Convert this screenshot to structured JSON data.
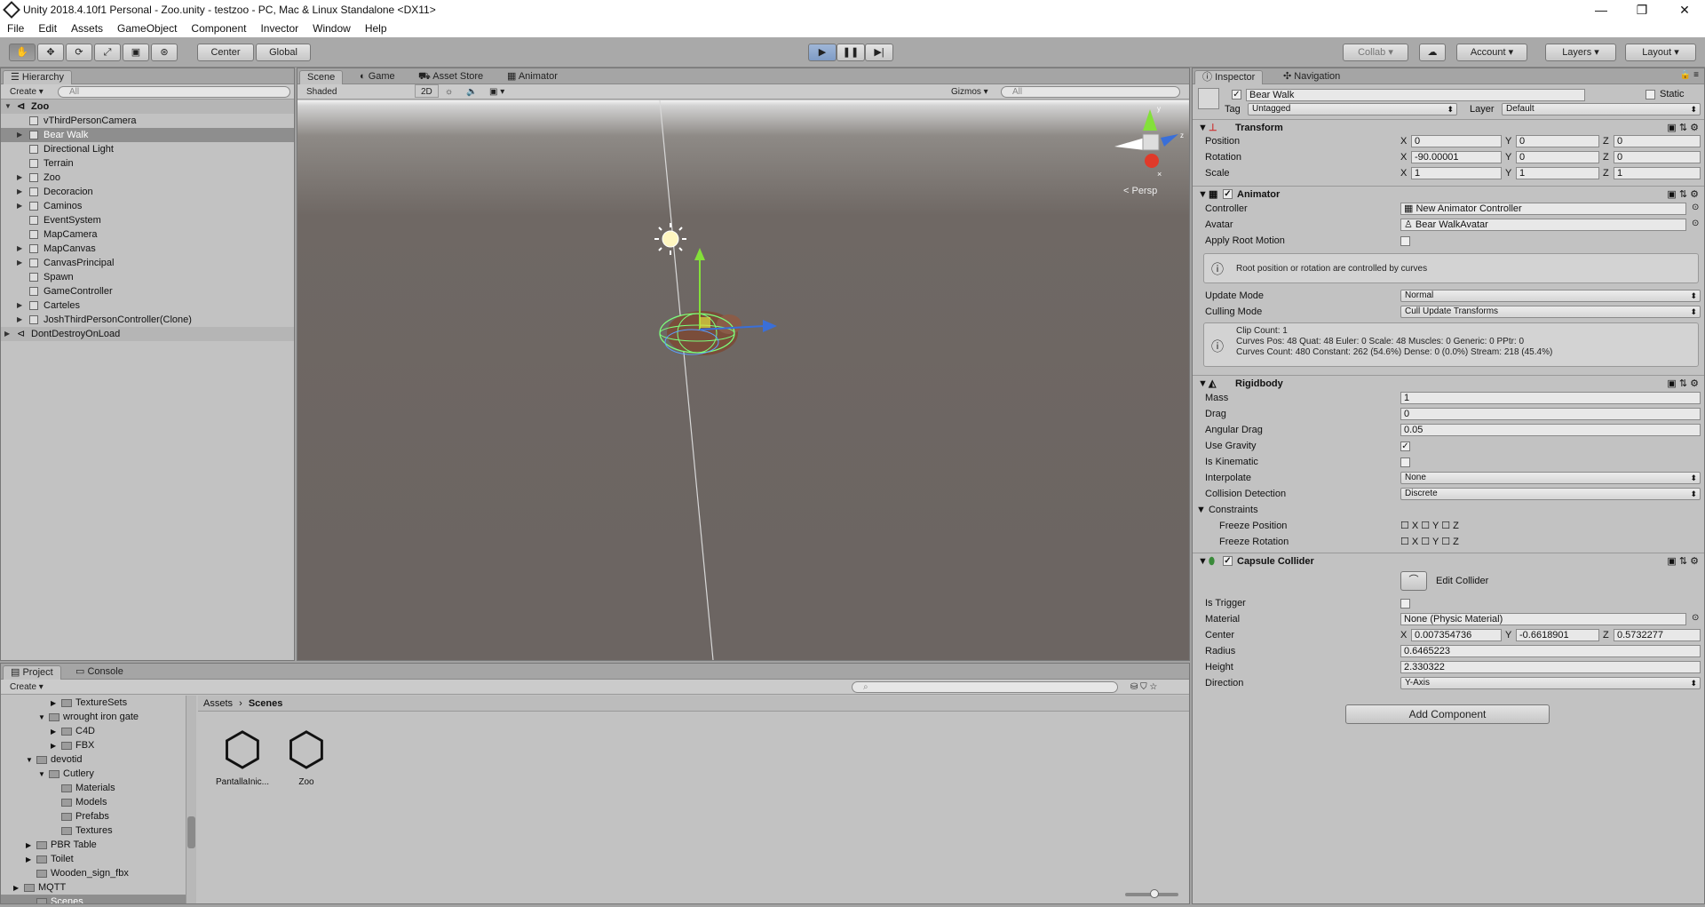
{
  "window": {
    "title": "Unity 2018.4.10f1 Personal - Zoo.unity - testzoo - PC, Mac & Linux Standalone <DX11>"
  },
  "menu": [
    "File",
    "Edit",
    "Assets",
    "GameObject",
    "Component",
    "Invector",
    "Window",
    "Help"
  ],
  "toolbar": {
    "center": "Center",
    "global": "Global",
    "collab": "Collab ▾",
    "account": "Account",
    "layers": "Layers",
    "layout": "Layout"
  },
  "hierarchy": {
    "tab": "Hierarchy",
    "create": "Create ▾",
    "search_placeholder": "All",
    "scene_root": "Zoo",
    "items": [
      {
        "label": "vThirdPersonCamera",
        "arrow": false,
        "selected": false
      },
      {
        "label": "Bear Walk",
        "arrow": true,
        "selected": true
      },
      {
        "label": "Directional Light",
        "arrow": false,
        "selected": false
      },
      {
        "label": "Terrain",
        "arrow": false,
        "selected": false
      },
      {
        "label": "Zoo",
        "arrow": true,
        "selected": false
      },
      {
        "label": "Decoracion",
        "arrow": true,
        "selected": false
      },
      {
        "label": "Caminos",
        "arrow": true,
        "selected": false
      },
      {
        "label": "EventSystem",
        "arrow": false,
        "selected": false
      },
      {
        "label": "MapCamera",
        "arrow": false,
        "selected": false
      },
      {
        "label": "MapCanvas",
        "arrow": true,
        "selected": false
      },
      {
        "label": "CanvasPrincipal",
        "arrow": true,
        "selected": false
      },
      {
        "label": "Spawn",
        "arrow": false,
        "selected": false
      },
      {
        "label": "GameController",
        "arrow": false,
        "selected": false
      },
      {
        "label": "Carteles",
        "arrow": true,
        "selected": false
      },
      {
        "label": "JoshThirdPersonController(Clone)",
        "arrow": true,
        "selected": false
      }
    ],
    "dont_destroy": "DontDestroyOnLoad"
  },
  "scene": {
    "tabs": [
      "Scene",
      "Game",
      "Asset Store",
      "Animator"
    ],
    "shading": "Shaded",
    "mode2d": "2D",
    "gizmos": "Gizmos",
    "search_placeholder": "All",
    "persp": "< Persp"
  },
  "inspector": {
    "tabs": [
      "Inspector",
      "Navigation"
    ],
    "object_name": "Bear Walk",
    "static": "Static",
    "tag_label": "Tag",
    "tag_value": "Untagged",
    "layer_label": "Layer",
    "layer_value": "Default",
    "transform": {
      "title": "Transform",
      "position": {
        "label": "Position",
        "x": "0",
        "y": "0",
        "z": "0"
      },
      "rotation": {
        "label": "Rotation",
        "x": "-90.00001",
        "y": "0",
        "z": "0"
      },
      "scale": {
        "label": "Scale",
        "x": "1",
        "y": "1",
        "z": "1"
      }
    },
    "animator": {
      "title": "Animator",
      "controller_label": "Controller",
      "controller_value": "New Animator Controller",
      "avatar_label": "Avatar",
      "avatar_value": "Bear WalkAvatar",
      "root_motion_label": "Apply Root Motion",
      "root_help": "Root position or rotation are controlled by curves",
      "update_mode_label": "Update Mode",
      "update_mode_value": "Normal",
      "culling_label": "Culling Mode",
      "culling_value": "Cull Update Transforms",
      "clip_info": [
        "Clip Count: 1",
        "Curves Pos: 48 Quat: 48 Euler: 0 Scale: 48 Muscles: 0 Generic: 0 PPtr: 0",
        "Curves Count: 480 Constant: 262 (54.6%) Dense: 0 (0.0%) Stream: 218 (45.4%)"
      ]
    },
    "rigidbody": {
      "title": "Rigidbody",
      "mass_label": "Mass",
      "mass": "1",
      "drag_label": "Drag",
      "drag": "0",
      "angular_label": "Angular Drag",
      "angular": "0.05",
      "gravity_label": "Use Gravity",
      "kinematic_label": "Is Kinematic",
      "interpolate_label": "Interpolate",
      "interpolate": "None",
      "collision_label": "Collision Detection",
      "collision": "Discrete",
      "constraints_label": "Constraints",
      "freeze_pos": "Freeze Position",
      "freeze_rot": "Freeze Rotation"
    },
    "capsule": {
      "title": "Capsule Collider",
      "edit": "Edit Collider",
      "trigger_label": "Is Trigger",
      "material_label": "Material",
      "material": "None (Physic Material)",
      "center_label": "Center",
      "cx": "0.007354736",
      "cy": "-0.6618901",
      "cz": "0.5732277",
      "radius_label": "Radius",
      "radius": "0.6465223",
      "height_label": "Height",
      "height": "2.330322",
      "direction_label": "Direction",
      "direction": "Y-Axis"
    },
    "add_component": "Add Component"
  },
  "project": {
    "tabs": [
      "Project",
      "Console"
    ],
    "create": "Create ▾",
    "tree": [
      {
        "label": "TextureSets",
        "indent": 3,
        "arrow": "▶"
      },
      {
        "label": "wrought iron gate",
        "indent": 2,
        "arrow": "▼"
      },
      {
        "label": "C4D",
        "indent": 3,
        "arrow": "▶"
      },
      {
        "label": "FBX",
        "indent": 3,
        "arrow": "▶"
      },
      {
        "label": "devotid",
        "indent": 1,
        "arrow": "▼"
      },
      {
        "label": "Cutlery",
        "indent": 2,
        "arrow": "▼"
      },
      {
        "label": "Materials",
        "indent": 3,
        "arrow": ""
      },
      {
        "label": "Models",
        "indent": 3,
        "arrow": ""
      },
      {
        "label": "Prefabs",
        "indent": 3,
        "arrow": ""
      },
      {
        "label": "Textures",
        "indent": 3,
        "arrow": ""
      },
      {
        "label": "PBR Table",
        "indent": 1,
        "arrow": "▶"
      },
      {
        "label": "Toilet",
        "indent": 1,
        "arrow": "▶"
      },
      {
        "label": "Wooden_sign_fbx",
        "indent": 1,
        "arrow": ""
      },
      {
        "label": "MQTT",
        "indent": 0,
        "arrow": "▶"
      },
      {
        "label": "Scenes",
        "indent": 0,
        "arrow": ""
      }
    ],
    "breadcrumb": [
      "Assets",
      "Scenes"
    ],
    "assets": [
      "PantallaInic...",
      "Zoo"
    ]
  }
}
